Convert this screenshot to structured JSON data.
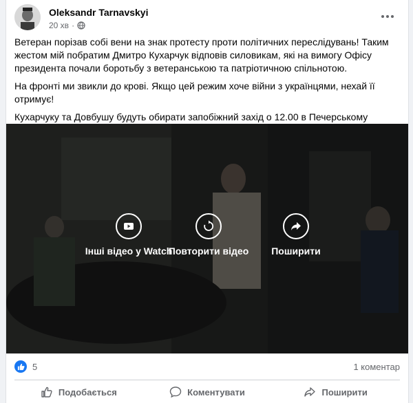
{
  "post": {
    "author": "Oleksandr Tarnavskyi",
    "time": "20 хв",
    "separator": "·",
    "paragraphs": [
      "Ветеран порізав собі вени на знак протесту проти політичних переслідувань! Таким жестом мій побратим Дмитро Кухарчук відповів силовикам, які на вимогу Офісу президента почали боротьбу з ветеранською та патріотичною спільнотою.",
      "На фронті ми звикли до крові. Якщо цей режим хоче війни з українцями, нехай її отримує!",
      "Кухарчуку та Довбушу будуть обирати запобіжний захід о 12.00 в Печерському районному суді міста Києва. Підтягуйтесь всі, хто за Україну!"
    ]
  },
  "video": {
    "buttons": [
      {
        "label": "Інші відео у Watch",
        "icon": "watch-icon"
      },
      {
        "label": "Повторити відео",
        "icon": "replay-icon"
      },
      {
        "label": "Поширити",
        "icon": "share-icon"
      }
    ]
  },
  "stats": {
    "likes": "5",
    "comments": "1 коментар"
  },
  "actions": {
    "like": "Подобається",
    "comment": "Коментувати",
    "share": "Поширити"
  },
  "colors": {
    "accent": "#1877f2",
    "secondary_text": "#65676b"
  }
}
